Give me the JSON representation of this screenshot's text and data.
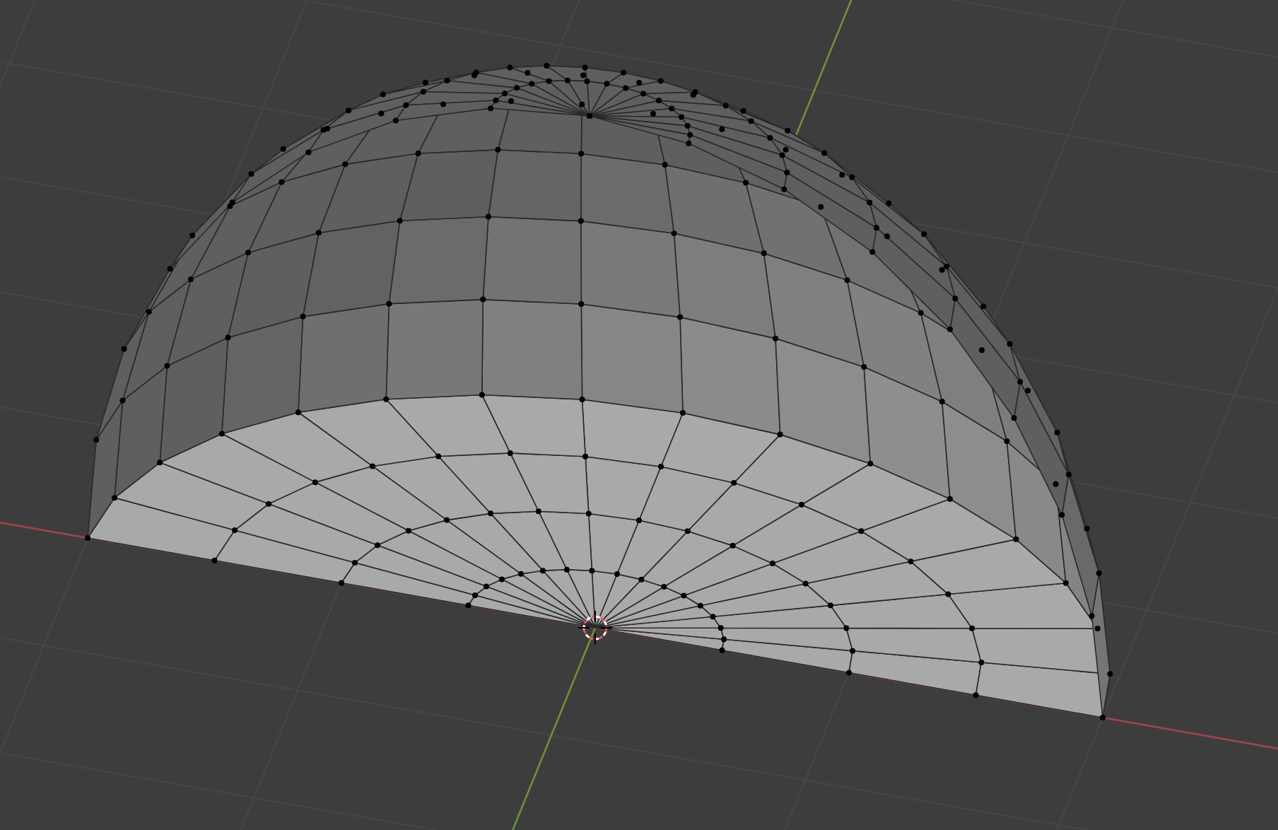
{
  "viewport": {
    "show_grid": true,
    "show_axes": true,
    "show_cursor": true,
    "show_vertices": true
  }
}
